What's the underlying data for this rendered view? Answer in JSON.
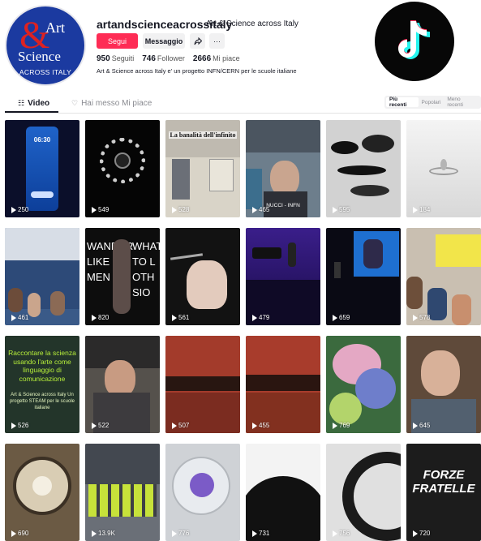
{
  "profile": {
    "username": "artandscienceacrossitaly",
    "nickname": "Art & Science across Italy",
    "bio": "Art & Science across Italy e' un progetto INFN/CERN per le scuole italiane",
    "follow_label": "Segui",
    "message_label": "Messaggio",
    "more_label": "···",
    "stats": [
      {
        "value": "950",
        "label": "Seguiti"
      },
      {
        "value": "746",
        "label": "Follower"
      },
      {
        "value": "2666",
        "label": "Mi piace"
      }
    ],
    "avatar": {
      "amp": "&",
      "art": "Art",
      "science": "Science",
      "across": "ACROSS ITALY"
    }
  },
  "tabs": {
    "video": "Video",
    "liked": "Hai messo Mi piace"
  },
  "sort": {
    "options": [
      "Più recenti",
      "Popolari",
      "Meno recenti"
    ],
    "active": "Più recenti"
  },
  "videos": [
    {
      "views": "250"
    },
    {
      "views": "549"
    },
    {
      "views": "528"
    },
    {
      "views": "465"
    },
    {
      "views": "595"
    },
    {
      "views": "184"
    },
    {
      "views": "461"
    },
    {
      "views": "820"
    },
    {
      "views": "561"
    },
    {
      "views": "479"
    },
    {
      "views": "659"
    },
    {
      "views": "578"
    },
    {
      "views": "526"
    },
    {
      "views": "522"
    },
    {
      "views": "507"
    },
    {
      "views": "455"
    },
    {
      "views": "769"
    },
    {
      "views": "645"
    },
    {
      "views": "690"
    },
    {
      "views": "13.9K"
    },
    {
      "views": "776"
    },
    {
      "views": "731"
    },
    {
      "views": "756"
    },
    {
      "views": "720"
    }
  ],
  "thumb_text": {
    "phone_time": "06:30",
    "banalita": "La banalità dell'infinito",
    "nuccio": "NUCCI - INFN",
    "raccontare": "Raccontare la scienza usando l'arte come linguaggio di comunicazione",
    "raccontare_sub": "Art & Science across Italy Un progetto STEAM per le scuole italiane",
    "forze": "FORZE FRATELLE",
    "wander": "WANDER LIKE MEN",
    "what": "WHAT TO L OTH SIO"
  },
  "colors": {
    "accent": "#fe2c55",
    "text": "#161823",
    "muted": "#8a8b91"
  }
}
